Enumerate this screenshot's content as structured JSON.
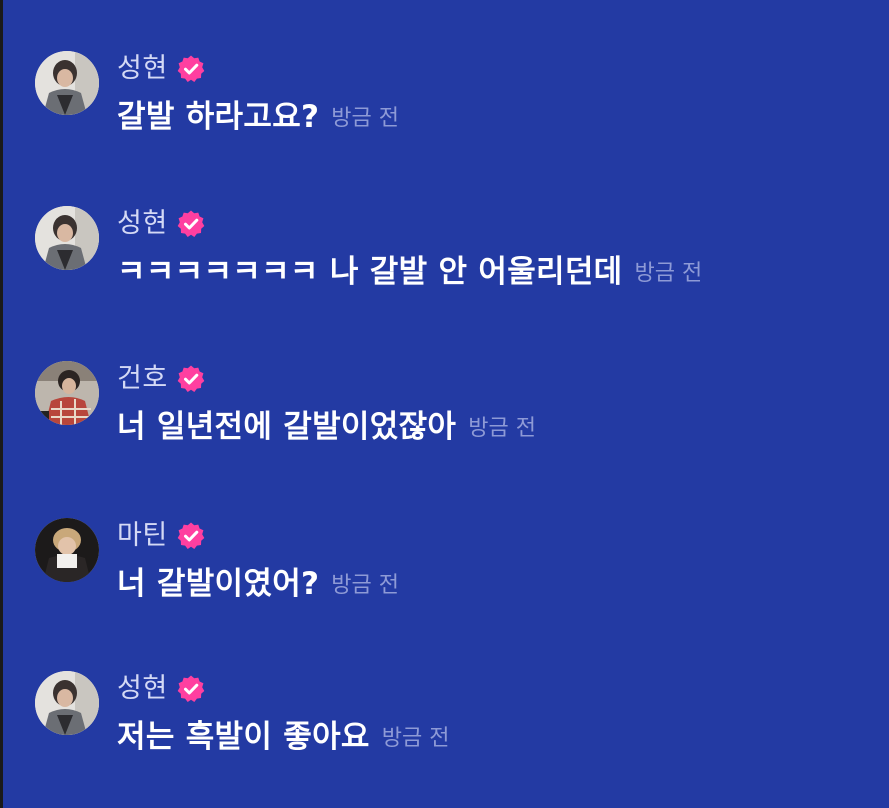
{
  "colors": {
    "background": "#233aa3",
    "name": "#d4d9f5",
    "message": "#ffffff",
    "time": "#8e9ad6",
    "badge": "#ff3fa0"
  },
  "messages": [
    {
      "name": "성현",
      "avatar": "avatar-seonghyeon",
      "text": "갈발 하라고요?",
      "time": "방금 전"
    },
    {
      "name": "성현",
      "avatar": "avatar-seonghyeon",
      "text": "ㅋㅋㅋㅋㅋㅋㅋ 나 갈발 안 어울리던데",
      "time": "방금 전"
    },
    {
      "name": "건호",
      "avatar": "avatar-geonho",
      "text": "너 일년전에 갈발이었잖아",
      "time": "방금 전"
    },
    {
      "name": "마틴",
      "avatar": "avatar-martin",
      "text": "너 갈발이였어?",
      "time": "방금 전"
    },
    {
      "name": "성현",
      "avatar": "avatar-seonghyeon",
      "text": "저는 흑발이 좋아요",
      "time": "방금 전"
    }
  ]
}
